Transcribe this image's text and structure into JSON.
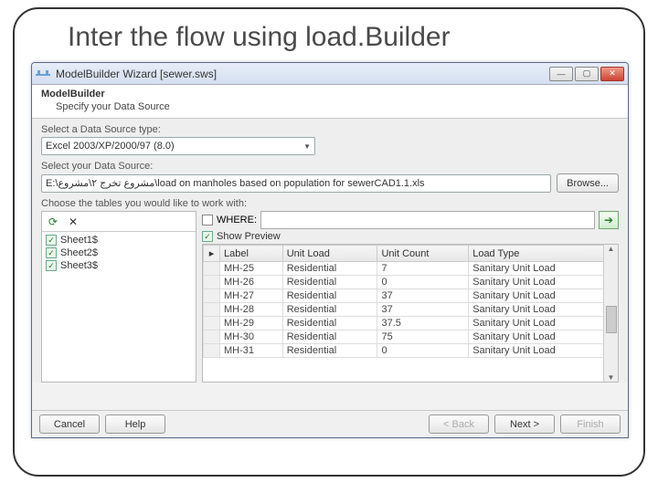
{
  "slide": {
    "title": "Inter the flow using load.Builder"
  },
  "window": {
    "title": "ModelBuilder Wizard [sewer.sws]",
    "header_title": "ModelBuilder",
    "header_subtitle": "Specify your Data Source"
  },
  "labels": {
    "select_type": "Select a Data Source type:",
    "select_source": "Select your Data Source:",
    "choose_tables": "Choose the tables you would like to work with:",
    "where": "WHERE:",
    "show_preview": "Show Preview",
    "browse": "Browse..."
  },
  "datasource": {
    "type": "Excel 2003/XP/2000/97 (8.0)",
    "path": "E:\\مشروع تخرج ٢\\مشروع\\load on manholes based on population for sewerCAD1.1.xls"
  },
  "sheets": [
    {
      "name": "Sheet1$",
      "checked": true
    },
    {
      "name": "Sheet2$",
      "checked": true
    },
    {
      "name": "Sheet3$",
      "checked": true
    }
  ],
  "grid": {
    "columns": [
      "",
      "Label",
      "Unit Load",
      "Unit Count",
      "Load Type"
    ],
    "rows": [
      [
        "",
        "MH-25",
        "Residential",
        "7",
        "Sanitary Unit Load"
      ],
      [
        "",
        "MH-26",
        "Residential",
        "0",
        "Sanitary Unit Load"
      ],
      [
        "",
        "MH-27",
        "Residential",
        "37",
        "Sanitary Unit Load"
      ],
      [
        "",
        "MH-28",
        "Residential",
        "37",
        "Sanitary Unit Load"
      ],
      [
        "",
        "MH-29",
        "Residential",
        "37.5",
        "Sanitary Unit Load"
      ],
      [
        "",
        "MH-30",
        "Residential",
        "75",
        "Sanitary Unit Load"
      ],
      [
        "",
        "MH-31",
        "Residential",
        "0",
        "Sanitary Unit Load"
      ]
    ]
  },
  "footer": {
    "cancel": "Cancel",
    "help": "Help",
    "back": "< Back",
    "next": "Next >",
    "finish": "Finish"
  }
}
